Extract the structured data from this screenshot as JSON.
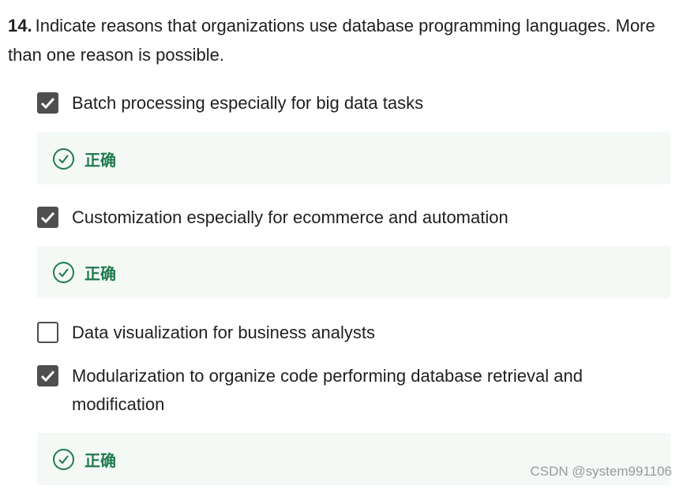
{
  "question": {
    "number": "14.",
    "text": "Indicate reasons that organizations use database programming languages. More than one reason is possible."
  },
  "options": [
    {
      "label": "Batch processing especially for big data tasks",
      "checked": true
    },
    {
      "label": "Customization especially for ecommerce and automation",
      "checked": true
    },
    {
      "label": "Data visualization for business analysts",
      "checked": false
    },
    {
      "label": "Modularization to organize code performing database retrieval and modification",
      "checked": true
    }
  ],
  "feedback": {
    "correct_label": "正确"
  },
  "colors": {
    "correct_green": "#1f7a4d",
    "feedback_bg": "#f4f9f6",
    "checkbox_fill": "#4f4f4f"
  },
  "watermark": "CSDN @system991106"
}
